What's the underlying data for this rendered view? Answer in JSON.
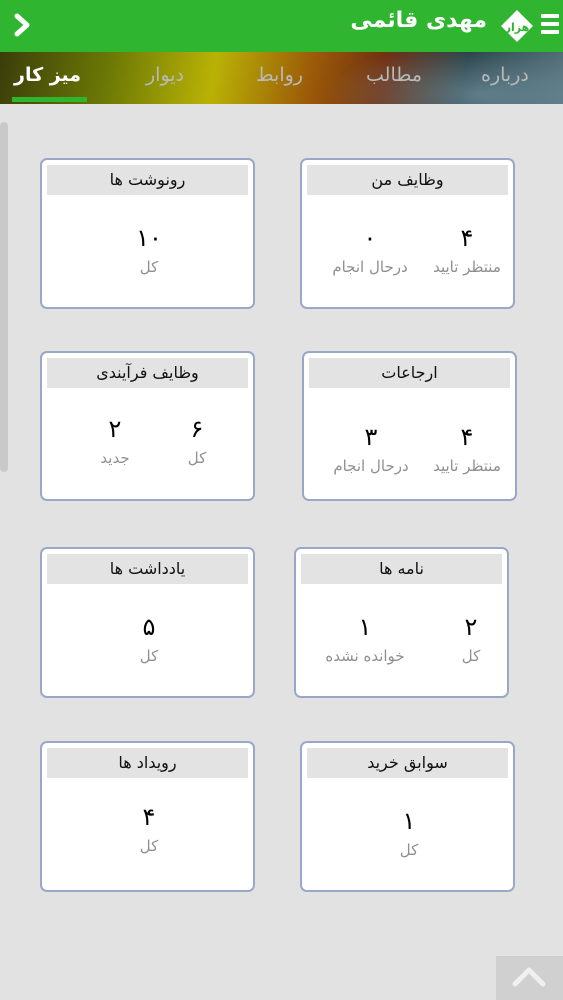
{
  "header": {
    "back_icon": "chevron-right-icon",
    "title": "مهدی قائمی",
    "logo_text": "هزار",
    "menu_icon": "hamburger-menu-icon"
  },
  "tabs": [
    {
      "label": "میز کار",
      "active": true
    },
    {
      "label": "دیوار",
      "active": false
    },
    {
      "label": "روابط",
      "active": false
    },
    {
      "label": "مطالب",
      "active": false
    },
    {
      "label": "درباره",
      "active": false
    }
  ],
  "cards": {
    "my_tasks": {
      "title": "وظایف من",
      "stats": [
        {
          "value": "۴",
          "label": "منتظر تایید"
        },
        {
          "value": "۰",
          "label": "درحال انجام"
        }
      ]
    },
    "copies": {
      "title": "رونوشت ها",
      "stats": [
        {
          "value": "۱۰",
          "label": "کل"
        }
      ]
    },
    "referrals": {
      "title": "ارجاعات",
      "stats": [
        {
          "value": "۴",
          "label": "منتظر تایید"
        },
        {
          "value": "۳",
          "label": "درحال انجام"
        }
      ]
    },
    "process_tasks": {
      "title": "وظایف فرآیندی",
      "stats": [
        {
          "value": "۶",
          "label": "کل"
        },
        {
          "value": "۲",
          "label": "جدید"
        }
      ]
    },
    "letters": {
      "title": "نامه ها",
      "stats": [
        {
          "value": "۲",
          "label": "کل"
        },
        {
          "value": "۱",
          "label": "خوانده نشده"
        }
      ]
    },
    "notes": {
      "title": "یادداشت ها",
      "stats": [
        {
          "value": "۵",
          "label": "کل"
        }
      ]
    },
    "purchases": {
      "title": "سوابق خرید",
      "stats": [
        {
          "value": "۱",
          "label": "کل"
        }
      ]
    },
    "events": {
      "title": "رویداد ها",
      "stats": [
        {
          "value": "۴",
          "label": "کل"
        }
      ]
    }
  },
  "scroll_top_icon": "chevron-up-icon",
  "colors": {
    "accent": "#2fb52f",
    "card_border": "#9aa8c8",
    "label_gray": "#8f8f8f"
  }
}
